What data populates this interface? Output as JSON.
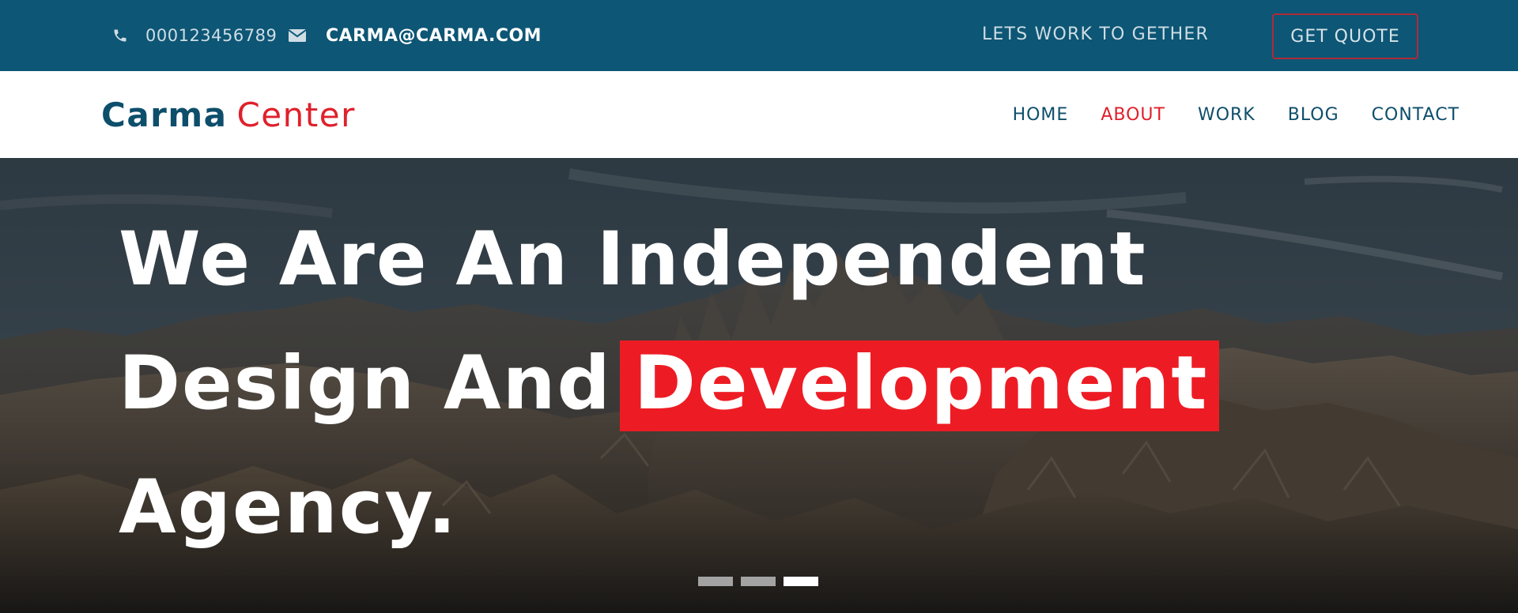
{
  "topbar": {
    "phone": "000123456789",
    "email": "CARMA@CARMA.COM",
    "tagline": "LETS WORK TO GETHER",
    "quote_button": "GET QUOTE",
    "icons": {
      "phone": "phone-icon",
      "email": "envelope-icon"
    }
  },
  "navbar": {
    "logo": {
      "part1": "Carma",
      "part2": "Center"
    },
    "items": [
      {
        "label": "HOME",
        "active": false
      },
      {
        "label": "ABOUT",
        "active": true
      },
      {
        "label": "WORK",
        "active": false
      },
      {
        "label": "BLOG",
        "active": false
      },
      {
        "label": "CONTACT",
        "active": false
      }
    ]
  },
  "hero": {
    "line1": "We Are An Independent",
    "line2_prefix": "Design And",
    "line2_highlight": "Development",
    "line3": "Agency.",
    "slides": {
      "count": 3,
      "active": 3
    }
  },
  "colors": {
    "topbar": "#0d5675",
    "brand_dark": "#0d4e6b",
    "accent": "#e0202b",
    "highlight": "#ed1c24"
  }
}
